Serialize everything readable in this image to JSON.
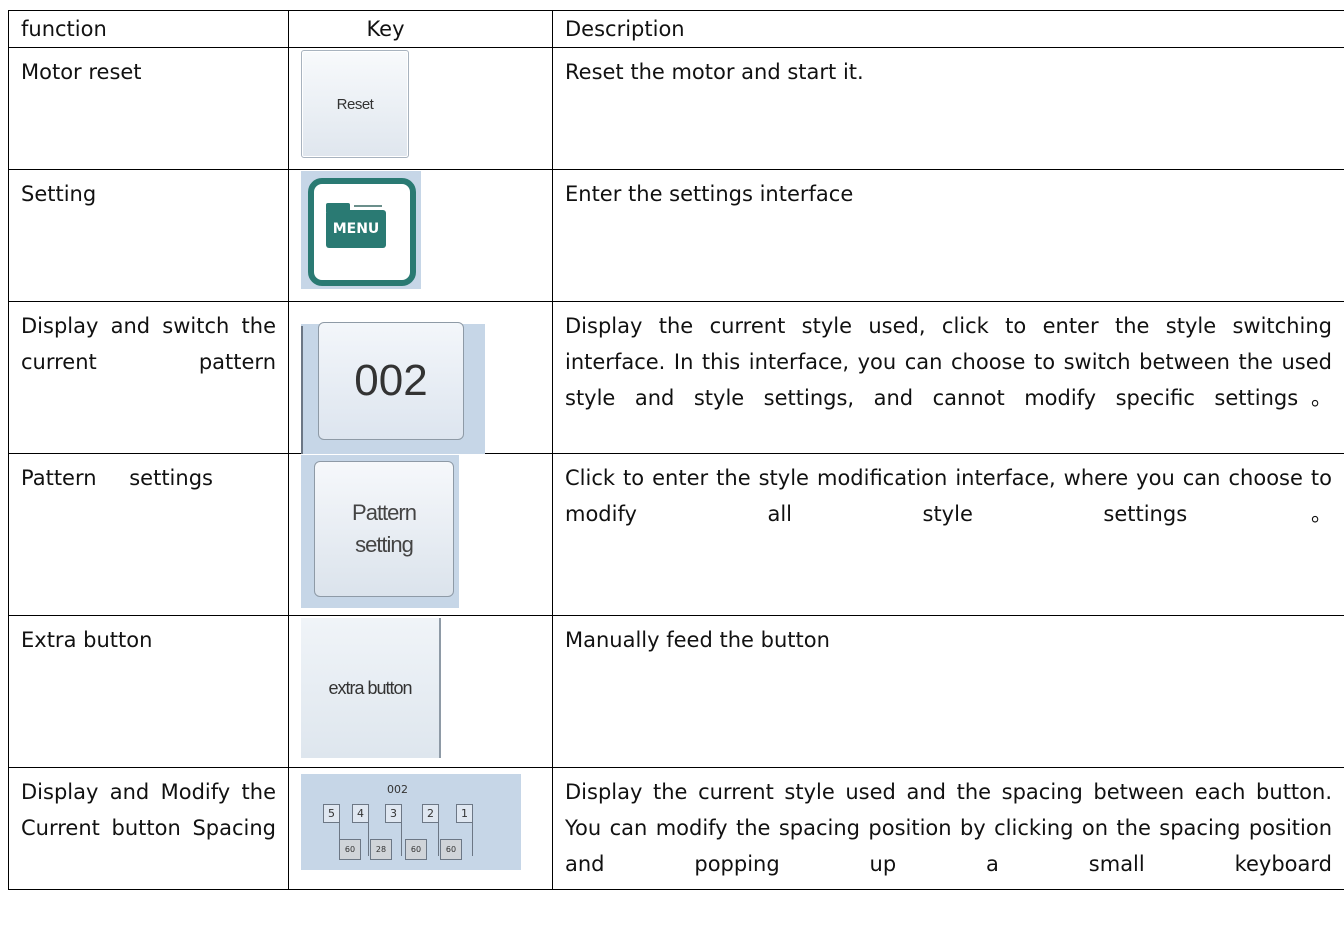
{
  "header": {
    "function": "function",
    "key": "Key",
    "description": "Description"
  },
  "rows": [
    {
      "function": "Motor reset",
      "key_label": "Reset",
      "description": "Reset the motor and start it."
    },
    {
      "function": "Setting",
      "key_label": "MENU",
      "description": "Enter the settings interface"
    },
    {
      "function": "Display and switch the current pattern",
      "key_label": "002",
      "description": "Display the current style used, click to enter the style switching interface. In this interface, you can choose to switch between the used style and style settings, and cannot modify specific settings。"
    },
    {
      "function": "Pattern settings",
      "key_label": "Pattern setting",
      "description": "Click to enter the style modification interface, where you can choose to modify all style settings。"
    },
    {
      "function": "Extra button",
      "key_label": "extra button",
      "description": "Manually feed the button"
    },
    {
      "function": "Display and Modify the Current button Spacing",
      "key_title": "002",
      "key_buttons": [
        "5",
        "4",
        "3",
        "2",
        "1"
      ],
      "key_spacings": [
        "60",
        "28",
        "60",
        "60"
      ],
      "description": "Display the current style used and the spacing between each button. You can modify the spacing position by clicking on the spacing position and popping up a small keyboard"
    }
  ]
}
